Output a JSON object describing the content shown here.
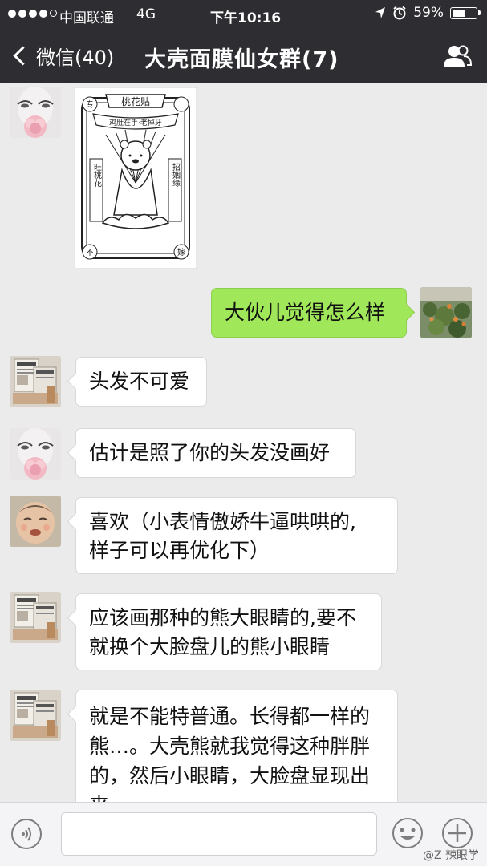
{
  "status_bar": {
    "carrier": "中国联通",
    "network": "4G",
    "time": "下午10:16",
    "battery_percent": "59%",
    "battery_level": 0.59
  },
  "nav": {
    "back_label": "微信(40)",
    "title": "大壳面膜仙女群(7)"
  },
  "messages": [
    {
      "side": "left",
      "type": "sticker",
      "avatar": "avatar-woman-flower"
    },
    {
      "side": "right",
      "type": "text",
      "text": "大伙儿觉得怎么样",
      "avatar": "avatar-garden"
    },
    {
      "side": "left",
      "type": "text",
      "text": "头发不可爱",
      "avatar": "avatar-newspaper"
    },
    {
      "side": "left",
      "type": "text",
      "text": "估计是照了你的头发没画好",
      "avatar": "avatar-woman-flower"
    },
    {
      "side": "left",
      "type": "text",
      "lines": [
        "喜欢（小表情傲娇牛逼哄哄的,",
        "样子可以再优化下）"
      ],
      "avatar": "avatar-baby"
    },
    {
      "side": "left",
      "type": "text",
      "lines": [
        "应该画那种的熊大眼睛的,要不",
        "就换个大脸盘儿的熊小眼睛"
      ],
      "avatar": "avatar-newspaper"
    },
    {
      "side": "left",
      "type": "text",
      "lines": [
        "就是不能特普通。长得都一样的",
        "熊…。大壳熊就我觉得这种胖胖",
        "的，然后小眼睛，大脸盘显现出",
        "来"
      ],
      "avatar": "avatar-newspaper"
    }
  ],
  "sticker": {
    "top_banner": "桃花贴",
    "ribbon": "鸡肚在手·老掉牙",
    "left_vertical": "旺桃花",
    "right_vertical": "招姻缘",
    "corner_left_top": "专",
    "corner_right_top": "",
    "corner_left_bottom": "不",
    "corner_right_bottom": "嫁"
  },
  "input_bar": {
    "placeholder": "",
    "voice_icon": "voice-icon",
    "emoji_icon": "emoji-icon",
    "plus_icon": "plus-icon"
  },
  "watermark": "@Z 辣眼学"
}
